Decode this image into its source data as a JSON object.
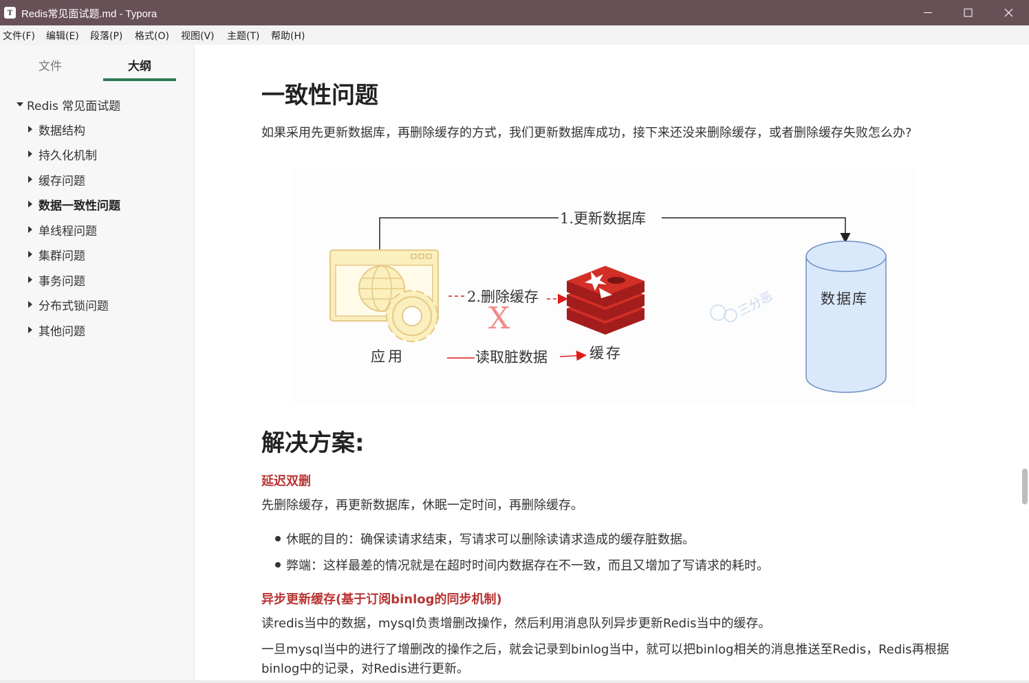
{
  "window": {
    "title": "Redis常见面试题.md - Typora",
    "app_icon_letter": "T"
  },
  "menu": [
    "文件(F)",
    "编辑(E)",
    "段落(P)",
    "格式(O)",
    "视图(V)",
    "主题(T)",
    "帮助(H)"
  ],
  "sidebar": {
    "tabs": [
      "文件",
      "大纲"
    ],
    "active_tab": "大纲",
    "outline_root": "Redis 常见面试题",
    "items": [
      "数据结构",
      "持久化机制",
      "缓存问题",
      "数据一致性问题",
      "单线程问题",
      "集群问题",
      "事务问题",
      "分布式锁问题",
      "其他问题"
    ],
    "active_item": "数据一致性问题"
  },
  "doc": {
    "heading1": "一致性问题",
    "intro": "如果采用先更新数据库，再删除缓存的方式，我们更新数据库成功，接下来还没来删除缓存，或者删除缓存失败怎么办?",
    "diagram": {
      "arrow_update_db": "1.更新数据库",
      "arrow_delete_cache": "2.删除缓存",
      "arrow_read_dirty": "读取脏数据",
      "app_label": "应用",
      "cache_label": "缓存",
      "db_label": "数据库",
      "failure_mark": "X",
      "watermark": "三分恶"
    },
    "heading2": "解决方案:",
    "section1_title": "延迟双删",
    "section1_text": "先删除缓存，再更新数据库，休眠一定时间，再删除缓存。",
    "section1_bullets": [
      "休眠的目的：确保读请求结束，写请求可以删除读请求造成的缓存脏数据。",
      "弊端：这样最差的情况就是在超时时间内数据存在不一致，而且又增加了写请求的耗时。"
    ],
    "section2_title": "异步更新缓存(基于订阅binlog的同步机制)",
    "section2_text1": "读redis当中的数据，mysql负责增删改操作，然后利用消息队列异步更新Redis当中的缓存。",
    "section2_text2": "一旦mysql当中的进行了增删改的操作之后，就会记录到binlog当中，就可以把binlog相关的消息推送至Redis，Redis再根据binlog中的记录，对Redis进行更新。"
  },
  "colors": {
    "titlebar": "#685057",
    "accent_green": "#2d7a55",
    "heading_red": "#b83433",
    "redis_red": "#d22f27",
    "app_yellow": "#fbefbd",
    "db_blue": "#dae8fc"
  }
}
